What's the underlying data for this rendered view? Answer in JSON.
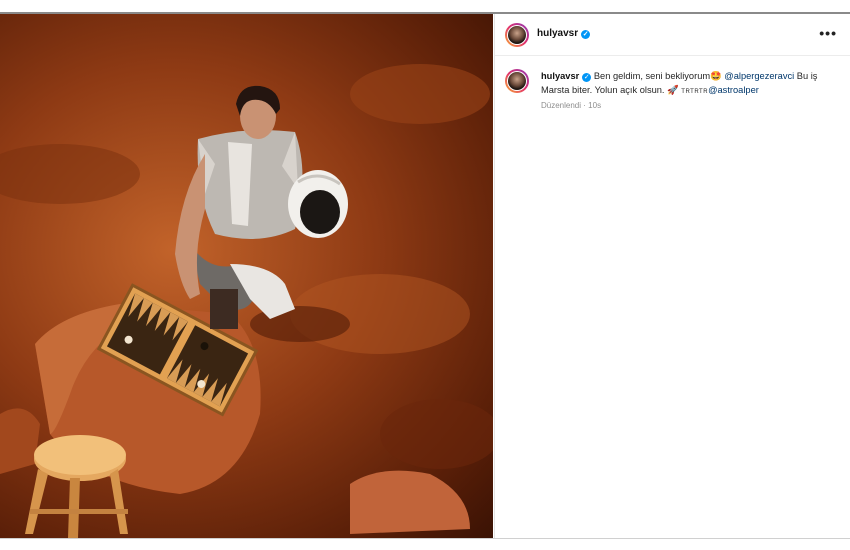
{
  "post": {
    "username": "hulyavsr",
    "verified_mark": "✓",
    "more_label": "•••",
    "caption": {
      "part1": "Ben geldim, seni bekliyorum",
      "emoji1": "🤩",
      "mention1": "@alpergezeravci",
      "part2": "Bu iş Marsta biter. Yolun açık olsun.",
      "emoji2": "🚀",
      "small_text": "TRTRTR",
      "mention2": "@astroalper"
    },
    "edited_label": "Düzenlendi",
    "separator": "·",
    "time": "10s"
  },
  "icons": {
    "verified": "verified-badge-icon",
    "more": "more-options-icon"
  },
  "colors": {
    "accent": "#0095f6",
    "mention": "#00376b",
    "mars": "#a8481a"
  }
}
